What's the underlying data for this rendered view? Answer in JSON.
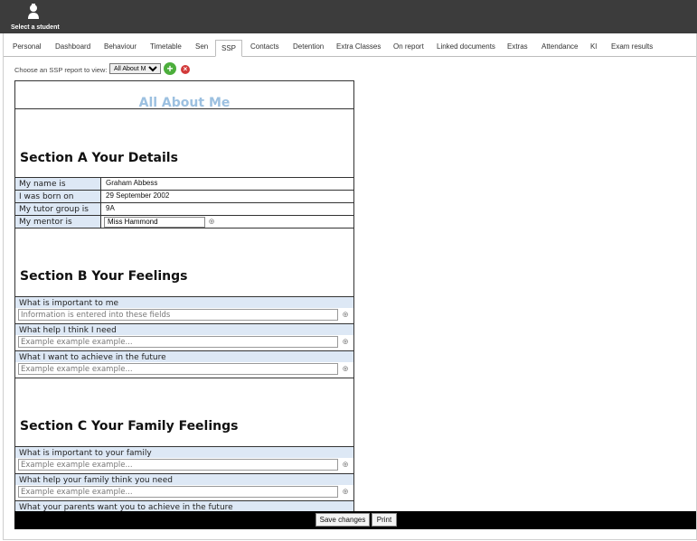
{
  "app": {
    "select_student_label": "Select a student"
  },
  "tabs": [
    {
      "label": "Personal"
    },
    {
      "label": "Dashboard"
    },
    {
      "label": "Behaviour"
    },
    {
      "label": "Timetable"
    },
    {
      "label": "Sen"
    },
    {
      "label": "SSP",
      "active": true
    },
    {
      "label": "Contacts"
    },
    {
      "label": "Detention"
    },
    {
      "label": "Extra Classes"
    },
    {
      "label": "On report"
    },
    {
      "label": "Linked documents"
    },
    {
      "label": "Extras"
    },
    {
      "label": "Attendance"
    },
    {
      "label": "Kl"
    },
    {
      "label": "Exam results"
    }
  ],
  "chooser": {
    "label": "Choose an SSP report to view:",
    "selected": "All About Me",
    "add_icon": "add-circle-icon",
    "delete_icon": "delete-circle-icon"
  },
  "form": {
    "title": "All About Me",
    "section_a": {
      "title": "Section A Your Details",
      "rows": [
        {
          "label": "My name is",
          "value": "Graham Abbess"
        },
        {
          "label": "I was born on",
          "value": "29 September 2002"
        },
        {
          "label": "My tutor group is",
          "value": "9A"
        },
        {
          "label": "My mentor is",
          "value": "Miss Hammond"
        }
      ]
    },
    "section_b": {
      "title": "Section B Your Feelings",
      "questions": [
        {
          "label": "What is important to me",
          "value": "Information is entered into these fields"
        },
        {
          "label": "What help I think I need",
          "value": "Example example example..."
        },
        {
          "label": "What I want to achieve in the future",
          "value": "Example example example..."
        }
      ]
    },
    "section_c": {
      "title": "Section C Your Family Feelings",
      "questions": [
        {
          "label": "What is important to your family",
          "value": "Example example example..."
        },
        {
          "label": "What help your family think you need",
          "value": "Example example example..."
        },
        {
          "label": "What your parents want you to achieve in the future",
          "value": ""
        }
      ]
    }
  },
  "footer": {
    "save_label": "Save changes",
    "print_label": "Print"
  },
  "colors": {
    "topbar": "#3c3c3c",
    "title": "#9cc0e0",
    "label_bg": "#dde8f5",
    "add": "#4cae3c",
    "delete": "#d23a3a"
  }
}
